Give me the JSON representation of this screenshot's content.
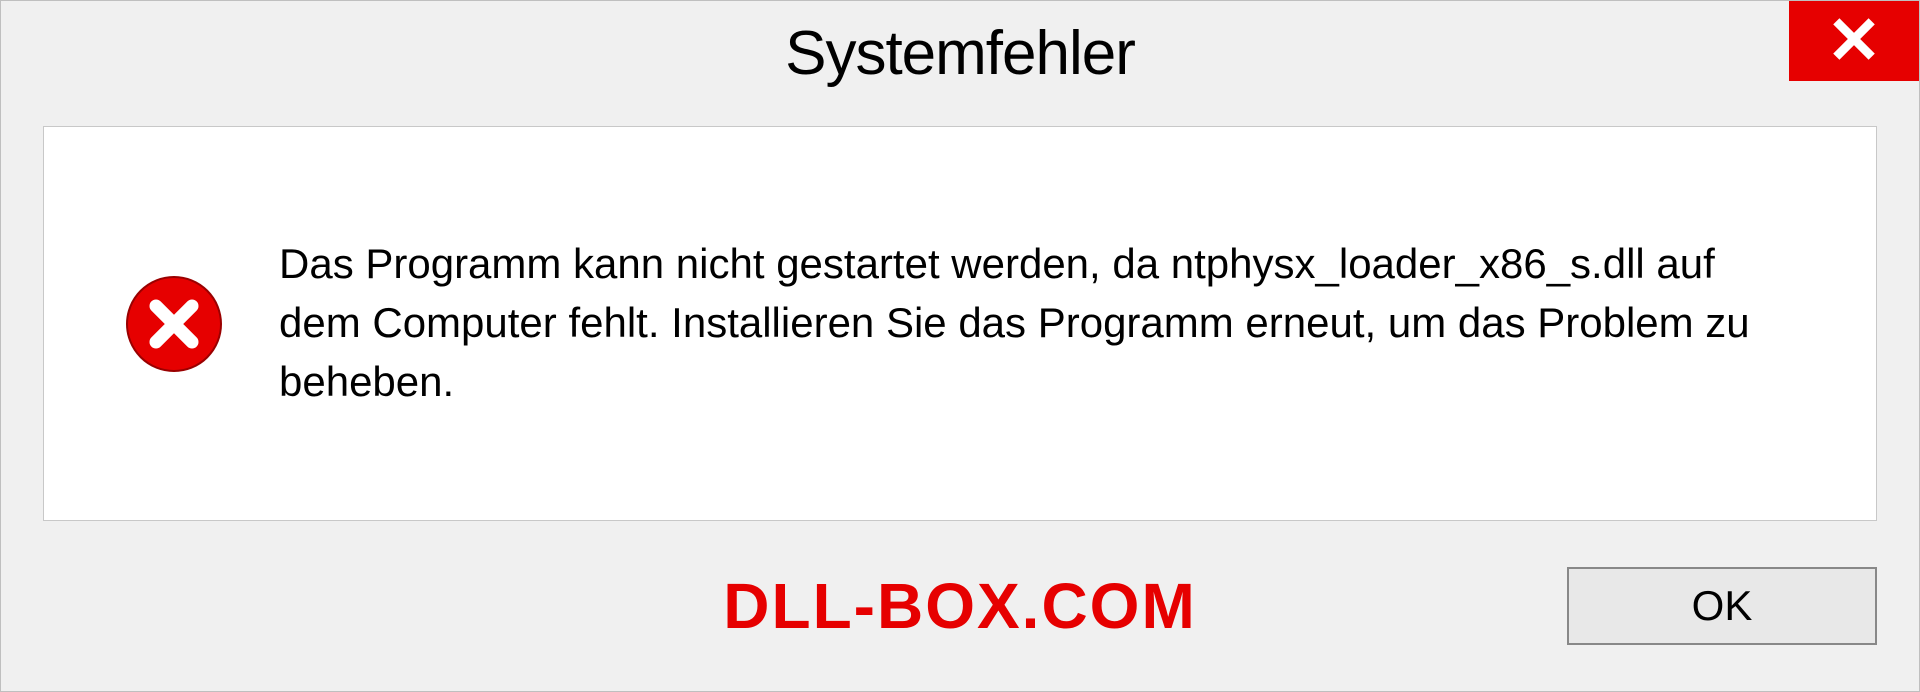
{
  "dialog": {
    "title": "Systemfehler",
    "message": "Das Programm kann nicht gestartet werden, da ntphysx_loader_x86_s.dll auf dem Computer fehlt. Installieren Sie das Programm erneut, um das Problem zu beheben.",
    "ok_label": "OK"
  },
  "watermark": "DLL-BOX.COM",
  "colors": {
    "error_red": "#e60000",
    "dialog_bg": "#f0f0f0",
    "content_bg": "#ffffff"
  }
}
